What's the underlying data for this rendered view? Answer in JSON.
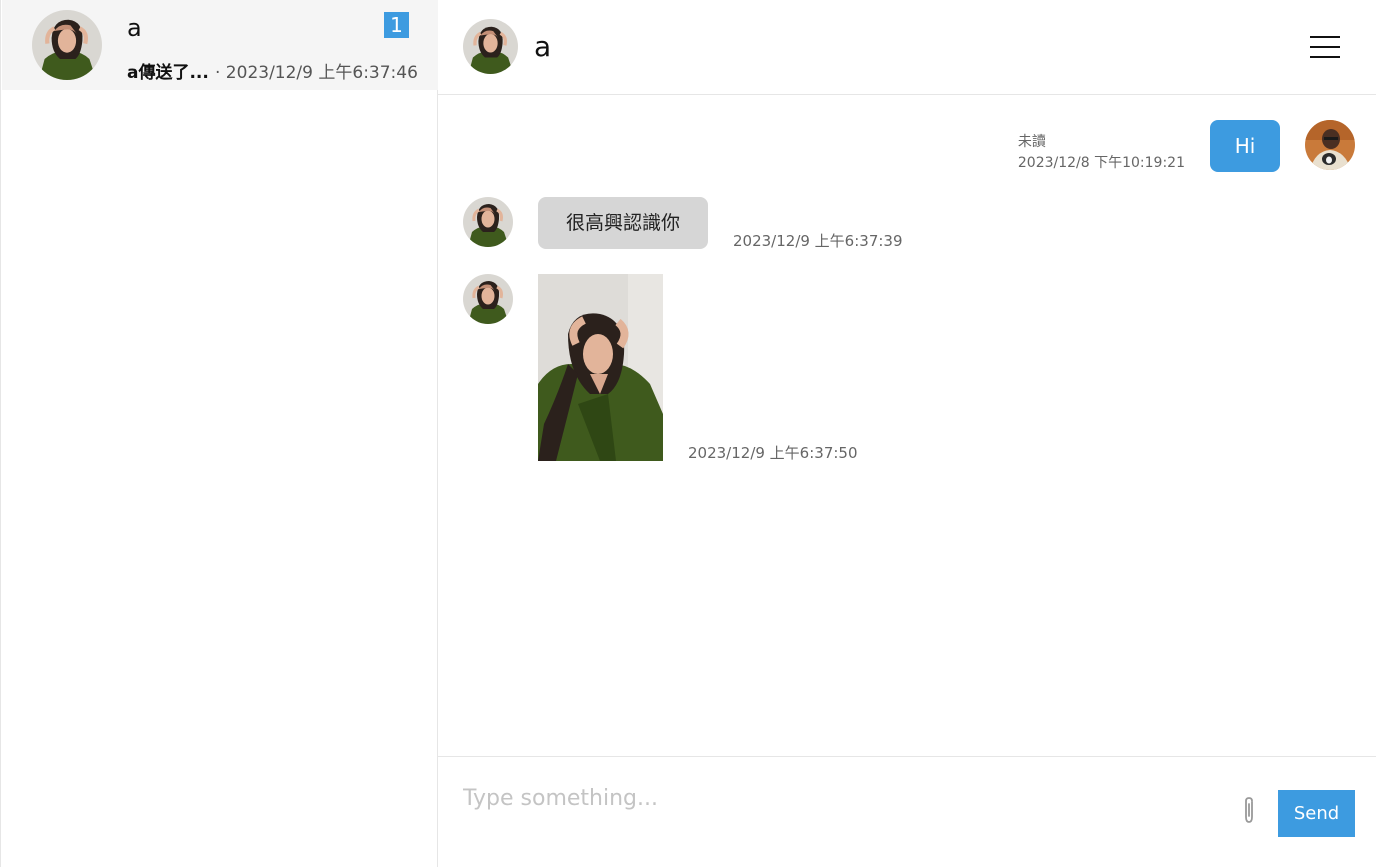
{
  "sidebar": {
    "conversations": [
      {
        "name": "a",
        "unread_count": "1",
        "preview": "a傳送了...",
        "time": "· 2023/12/9 上午6:37:46"
      }
    ]
  },
  "chat": {
    "header": {
      "name": "a"
    },
    "messages": [
      {
        "direction": "out",
        "text": "Hi",
        "status": "未讀",
        "time": "2023/12/8 下午10:19:21"
      },
      {
        "direction": "in",
        "text": "很高興認識你",
        "time": "2023/12/9 上午6:37:39"
      },
      {
        "direction": "in",
        "type": "image",
        "time": "2023/12/9 上午6:37:50"
      }
    ]
  },
  "composer": {
    "placeholder": "Type something...",
    "value": "",
    "send_label": "Send"
  },
  "colors": {
    "accent": "#3d9be0",
    "incoming_bubble": "#d6d6d6"
  },
  "icons": [
    "hamburger-menu-icon",
    "paperclip-icon"
  ]
}
